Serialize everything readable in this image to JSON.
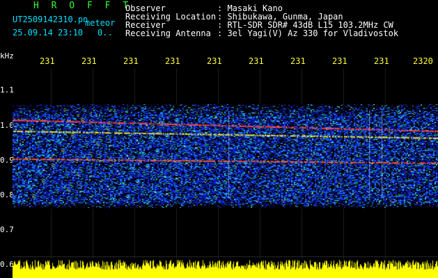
{
  "header": {
    "station_name": "H R O F F T",
    "filename": "UT2509142310.pn",
    "meteor_label": "meteor",
    "datetime": "25.09.14 23:10",
    "count": "0..",
    "fields": [
      {
        "label": "Observer",
        "value": ": Masaki Kano"
      },
      {
        "label": "Receiving Location",
        "value": ": Shibukawa, Gunma, Japan"
      },
      {
        "label": "Receiver",
        "value": ": RTL-SDR SDR# 43dB L15 103.2MHz CW"
      },
      {
        "label": "Receiving Antenna",
        "value": ": 3el Yagi(V) Az 330 for Vladivostok"
      }
    ]
  },
  "axis": {
    "unit": "kHz",
    "time_ticks": [
      "231",
      "231",
      "231",
      "231",
      "231",
      "231",
      "231",
      "231",
      "231",
      "2320"
    ],
    "freq_ticks": [
      "1.1",
      "1.0",
      "0.9",
      "0.8",
      "0.7",
      "0.6"
    ]
  },
  "colors": {
    "header_text": "#ffffff",
    "station_name": "#33ff33",
    "filename": "#00e0ff",
    "time_labels": "#ffff33",
    "noise_bar": "#ffff00"
  }
}
